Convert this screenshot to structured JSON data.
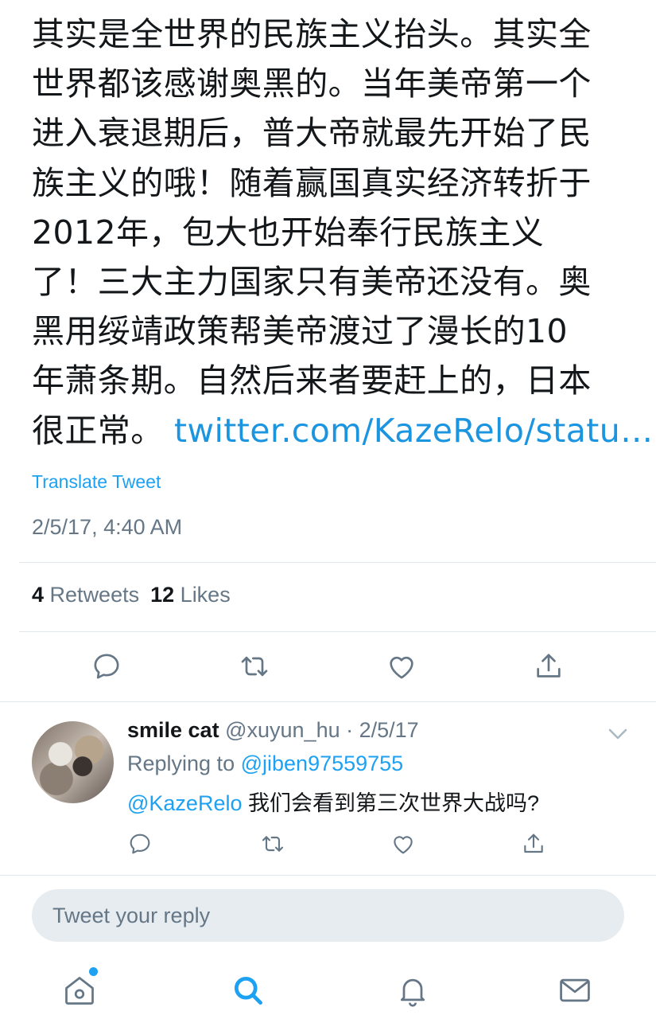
{
  "tweet": {
    "lines": [
      "其实是全世界的民族主义抬头。其实全",
      "世界都该感谢奥黑的。当年美帝第一个",
      "进入衰退期后，普大帝就最先开始了民",
      "族主义的哦！随着赢国真实经济转折于",
      "2012年，包大也开始奉行民族主义",
      "了！三大主力国家只有美帝还没有。奥",
      "黑用绥靖政策帮美帝渡过了漫长的10",
      "年萧条期。自然后来者要赶上的，日本"
    ],
    "last_line_prefix": "很正常。",
    "link_text": "twitter.com/KazeRelo/statu…",
    "translate_label": "Translate Tweet",
    "timestamp": "2/5/17, 4:40 AM"
  },
  "stats": {
    "retweets_count": "4",
    "retweets_label": "Retweets",
    "likes_count": "12",
    "likes_label": "Likes"
  },
  "reply": {
    "name": "smile cat",
    "handle_date": "@xuyun_hu · 2/5/17",
    "replying_prefix": "Replying to",
    "replying_to": "@jiben97559755",
    "mention": "@KazeRelo",
    "text": "我们会看到第三次世界大战吗?"
  },
  "composer": {
    "placeholder": "Tweet your reply"
  },
  "icons": {
    "reply": "reply-icon",
    "retweet": "retweet-icon",
    "like": "heart-icon",
    "share": "share-icon",
    "home": "home-icon",
    "search": "search-icon",
    "notifications": "bell-icon",
    "messages": "mail-icon"
  },
  "colors": {
    "accent": "#1da1f2",
    "link": "#1b95e0",
    "muted": "#657786",
    "text": "#14171a",
    "divider": "#e1e8ed"
  }
}
